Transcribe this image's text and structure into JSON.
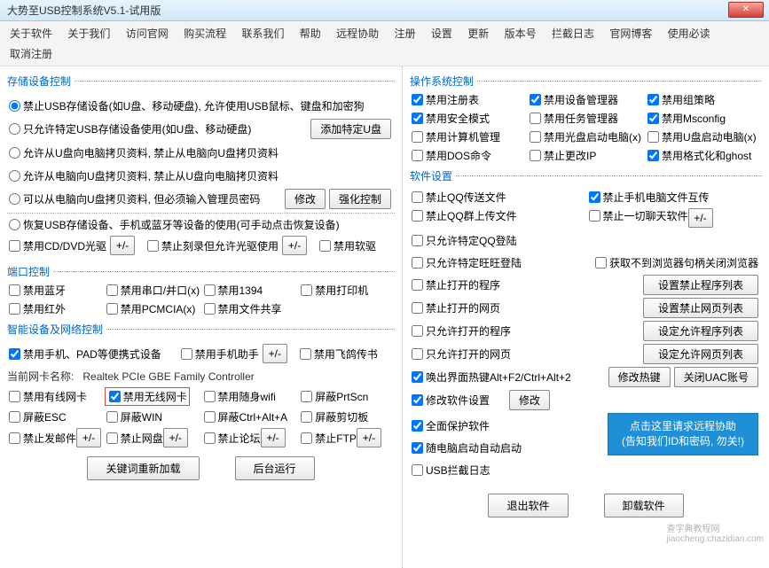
{
  "title": "大势至USB控制系统V5.1-试用版",
  "menu": [
    "关于软件",
    "关于我们",
    "访问官网",
    "购买流程",
    "联系我们",
    "帮助",
    "远程协助",
    "注册",
    "设置",
    "更新",
    "版本号",
    "拦截日志",
    "官网博客",
    "使用必读",
    "取消注册"
  ],
  "storage": {
    "legend": "存储设备控制",
    "r1": "禁止USB存储设备(如U盘、移动硬盘), 允许使用USB鼠标、键盘和加密狗",
    "r2": "只允许特定USB存储设备使用(如U盘、移动硬盘)",
    "btn_addusb": "添加特定U盘",
    "r3": "允许从U盘向电脑拷贝资料, 禁止从电脑向U盘拷贝资料",
    "r4": "允许从电脑向U盘拷贝资料, 禁止从U盘向电脑拷贝资料",
    "r5": "可以从电脑向U盘拷贝资料, 但必须输入管理员密码",
    "btn_modify": "修改",
    "btn_force": "强化控制",
    "r6": "恢复USB存储设备、手机或蓝牙等设备的使用(可手动点击恢复设备)",
    "cb_cddvd": "禁用CD/DVD光驱",
    "cb_burn": "禁止刻录但允许光驱使用",
    "cb_floppy": "禁用软驱",
    "plus": "+/-"
  },
  "port": {
    "legend": "端口控制",
    "bt": "禁用蓝牙",
    "serial": "禁用串口/并口(x)",
    "p1394": "禁用1394",
    "printer": "禁用打印机",
    "ir": "禁用红外",
    "pcmcia": "禁用PCMCIA(x)",
    "share": "禁用文件共享"
  },
  "smart": {
    "legend": "智能设备及网络控制",
    "phone": "禁用手机、PAD等便携式设备",
    "helper": "禁用手机助手",
    "book": "禁用飞鸽传书",
    "netlabel": "当前网卡名称:",
    "netval": "Realtek PCIe GBE Family Controller",
    "wired": "禁用有线网卡",
    "wifi": "禁用无线网卡",
    "adhoc": "禁用随身wifi",
    "prtscn": "屏蔽PrtScn",
    "esc": "屏蔽ESC",
    "win": "屏蔽WIN",
    "ctrlalta": "屏蔽Ctrl+Alt+A",
    "clip": "屏蔽剪切板",
    "mail": "禁止发邮件",
    "netdisk": "禁止网盘",
    "bbs": "禁止论坛",
    "ftp": "禁止FTP",
    "plus": "+/-"
  },
  "os": {
    "legend": "操作系统控制",
    "reg": "禁用注册表",
    "devmgr": "禁用设备管理器",
    "gpol": "禁用组策略",
    "safe": "禁用安全模式",
    "task": "禁用任务管理器",
    "msconfig": "禁用Msconfig",
    "compmgr": "禁用计算机管理",
    "cdboot": "禁用光盘启动电脑(x)",
    "usbboot": "禁用U盘启动电脑(x)",
    "dos": "禁用DOS命令",
    "ip": "禁止更改IP",
    "ghost": "禁用格式化和ghost"
  },
  "sw": {
    "legend": "软件设置",
    "qqfile": "禁止QQ传送文件",
    "phonepc": "禁止手机电脑文件互传",
    "qqgroup": "禁止QQ群上传文件",
    "oneone": "禁止一切聊天软件",
    "onlyqq": "只允许特定QQ登陆",
    "onlyww": "只允许特定旺旺登陆",
    "noclose": "获取不到浏览器句柄关闭浏览器",
    "blockprog": "禁止打开的程序",
    "btn_blockprog": "设置禁止程序列表",
    "blockpage": "禁止打开的网页",
    "btn_blockpage": "设置禁止网页列表",
    "allowprog": "只允许打开的程序",
    "btn_allowprog": "设定允许程序列表",
    "allowpage": "只允许打开的网页",
    "btn_allowpage": "设定允许网页列表",
    "hotkey": "唤出界面热键Alt+F2/Ctrl+Alt+2",
    "btn_hotkey": "修改热键",
    "btn_uac": "关闭UAC账号",
    "config": "修改软件设置",
    "btn_config": "修改",
    "protectall": "全面保护软件",
    "autostart": "随电脑启动自动启动",
    "log": "USB拦截日志",
    "bluebox1": "点击这里请求远程协助",
    "bluebox2": "(告知我们ID和密码, 勿关!)",
    "plus": "+/-"
  },
  "bottom": {
    "reload": "关键词重新加载",
    "bg": "后台运行",
    "exit": "退出软件",
    "unload": "卸载软件"
  },
  "wm1": "查字典教程网",
  "wm2": "jiaocheng.chazidian.com"
}
